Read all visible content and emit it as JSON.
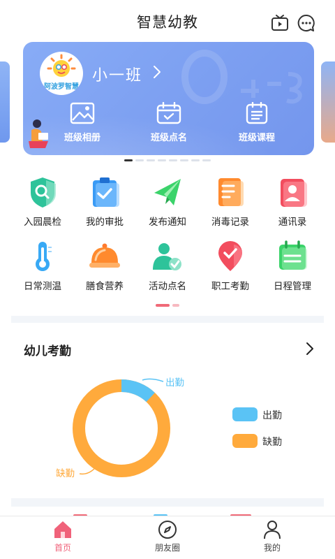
{
  "header": {
    "title": "智慧幼教"
  },
  "banner": {
    "logo_text": "阿波罗智慧",
    "class_name": "小一班",
    "items": [
      {
        "label": "班级相册",
        "icon": "photo-icon"
      },
      {
        "label": "班级点名",
        "icon": "calendar-check-icon"
      },
      {
        "label": "班级课程",
        "icon": "schedule-list-icon"
      }
    ],
    "carousel_index": 1,
    "carousel_count": 8
  },
  "grid": {
    "items": [
      {
        "label": "入园晨检",
        "icon": "shield-search-icon"
      },
      {
        "label": "我的审批",
        "icon": "clipboard-check-icon"
      },
      {
        "label": "发布通知",
        "icon": "paper-plane-icon"
      },
      {
        "label": "消毒记录",
        "icon": "document-icon"
      },
      {
        "label": "通讯录",
        "icon": "contacts-icon"
      },
      {
        "label": "日常测温",
        "icon": "thermometer-icon"
      },
      {
        "label": "膳食营养",
        "icon": "food-cloche-icon"
      },
      {
        "label": "活动点名",
        "icon": "user-check-icon"
      },
      {
        "label": "职工考勤",
        "icon": "location-heart-icon"
      },
      {
        "label": "日程管理",
        "icon": "calendar-icon"
      }
    ],
    "page_index": 1,
    "page_count": 2
  },
  "attendance": {
    "title": "幼儿考勤",
    "present_label": "出勤",
    "absent_label": "缺勤",
    "legend": [
      {
        "label": "出勤",
        "color": "#5ac3f5"
      },
      {
        "label": "缺勤",
        "color": "#ffaa3c"
      }
    ],
    "present_fraction": 0.12,
    "absent_fraction": 0.88
  },
  "tabbar": {
    "tabs": [
      {
        "label": "首页",
        "icon": "home-icon",
        "active": true
      },
      {
        "label": "朋友圈",
        "icon": "compass-icon",
        "active": false
      },
      {
        "label": "我的",
        "icon": "person-icon",
        "active": false
      }
    ]
  },
  "colors": {
    "accent": "#f0627a",
    "banner": "#7ea1f2",
    "present": "#5ac3f5",
    "absent": "#ffaa3c"
  }
}
